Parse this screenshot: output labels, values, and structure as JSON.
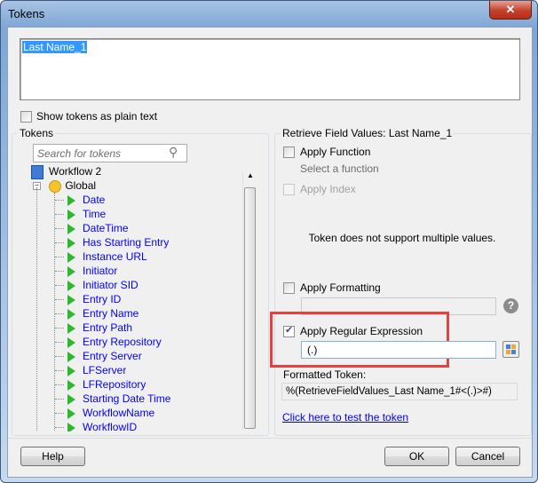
{
  "window": {
    "title": "Tokens",
    "close_icon": "close-icon"
  },
  "editor": {
    "value": "Last Name_1"
  },
  "show_plain": {
    "label": "Show tokens as plain text",
    "checked": false
  },
  "tokens": {
    "group_label": "Tokens",
    "search_placeholder": "Search for tokens",
    "root": "Workflow 2",
    "global": "Global",
    "items": [
      "Date",
      "Time",
      "DateTime",
      "Has Starting Entry",
      "Instance URL",
      "Initiator",
      "Initiator SID",
      "Entry ID",
      "Entry Name",
      "Entry Path",
      "Entry Repository",
      "Entry Server",
      "LFServer",
      "LFRepository",
      "Starting Date Time",
      "WorkflowName",
      "WorkflowID"
    ]
  },
  "retrieve": {
    "group_label": "Retrieve Field Values: Last Name_1",
    "apply_function": "Apply Function",
    "select_function": "Select a function",
    "apply_index": "Apply Index",
    "multi_note": "Token does not support multiple values.",
    "apply_formatting": "Apply Formatting",
    "formatting_value": "",
    "apply_regex": "Apply Regular Expression",
    "regex_value": "(.)",
    "formatted_label": "Formatted Token:",
    "formatted_value": "%(RetrieveFieldValues_Last Name_1#<(.)>#)",
    "test_link": "Click here to test the token",
    "highlight_color": "#e8403f"
  },
  "buttons": {
    "help": "Help",
    "ok": "OK",
    "cancel": "Cancel"
  }
}
